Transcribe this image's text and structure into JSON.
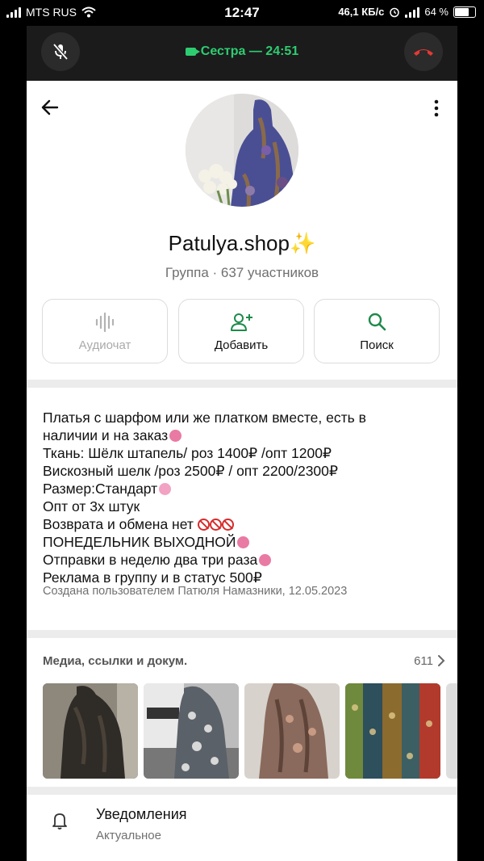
{
  "status_bar": {
    "carrier": "MTS RUS",
    "time": "12:47",
    "speed": "46,1 КБ/с",
    "battery": "64 %",
    "battery_level": 0.64
  },
  "call_bar": {
    "title": "Сестра — 24:51",
    "accent": "#2ecc71",
    "hangup_color": "#e53935"
  },
  "group": {
    "name": "Patulya.shop✨",
    "subtitle": "Группа · 637 участников"
  },
  "actions": [
    {
      "label": "Аудиочат",
      "icon": "audio-wave-icon",
      "enabled": false
    },
    {
      "label": "Добавить",
      "icon": "add-user-icon",
      "enabled": true
    },
    {
      "label": "Поиск",
      "icon": "search-icon",
      "enabled": true
    }
  ],
  "description": {
    "lines": [
      "Платья с шарфом или же платком вместе, есть в",
      "наличии и на заказ",
      "Ткань: Шёлк штапель/ роз 1400₽ /опт 1200₽",
      "Вискозный шелк /роз 2500₽ / опт 2200/2300₽",
      "Размер:Стандарт",
      "Опт от 3х штук",
      "Возврата и обмена нет",
      "ПОНЕДЕЛЬНИК ВЫХОДНОЙ",
      "Отправки в неделю два три раза",
      "Реклама в группу и в статус 500₽"
    ],
    "created": "Создана пользователем Патюля Намазники, 12.05.2023"
  },
  "media": {
    "title": "Медиа, ссылки и докум.",
    "count": "611"
  },
  "notifications": {
    "title": "Уведомления",
    "status": "Актуальное"
  }
}
